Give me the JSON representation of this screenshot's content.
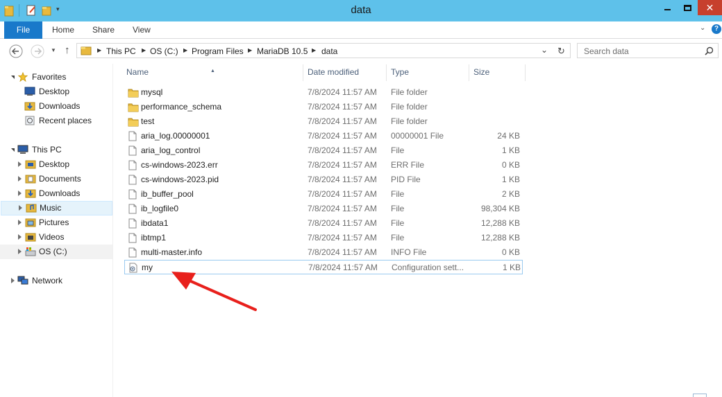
{
  "window": {
    "title": "data"
  },
  "ribbon": {
    "tabs": [
      "File",
      "Home",
      "Share",
      "View"
    ]
  },
  "address": {
    "crumbs": [
      "This PC",
      "OS (C:)",
      "Program Files",
      "MariaDB 10.5",
      "data"
    ]
  },
  "search": {
    "placeholder": "Search data"
  },
  "nav": {
    "favorites": "Favorites",
    "fav_items": [
      "Desktop",
      "Downloads",
      "Recent places"
    ],
    "this_pc": "This PC",
    "pc_items": [
      "Desktop",
      "Documents",
      "Downloads",
      "Music",
      "Pictures",
      "Videos",
      "OS (C:)"
    ],
    "network": "Network"
  },
  "columns": {
    "name": "Name",
    "date": "Date modified",
    "type": "Type",
    "size": "Size"
  },
  "files": [
    {
      "name": "mysql",
      "date": "7/8/2024 11:57 AM",
      "type": "File folder",
      "size": "",
      "icon": "folder-icon"
    },
    {
      "name": "performance_schema",
      "date": "7/8/2024 11:57 AM",
      "type": "File folder",
      "size": "",
      "icon": "folder-icon"
    },
    {
      "name": "test",
      "date": "7/8/2024 11:57 AM",
      "type": "File folder",
      "size": "",
      "icon": "folder-icon"
    },
    {
      "name": "aria_log.00000001",
      "date": "7/8/2024 11:57 AM",
      "type": "00000001 File",
      "size": "24 KB",
      "icon": "file-icon"
    },
    {
      "name": "aria_log_control",
      "date": "7/8/2024 11:57 AM",
      "type": "File",
      "size": "1 KB",
      "icon": "file-icon"
    },
    {
      "name": "cs-windows-2023.err",
      "date": "7/8/2024 11:57 AM",
      "type": "ERR File",
      "size": "0 KB",
      "icon": "file-icon"
    },
    {
      "name": "cs-windows-2023.pid",
      "date": "7/8/2024 11:57 AM",
      "type": "PID File",
      "size": "1 KB",
      "icon": "file-icon"
    },
    {
      "name": "ib_buffer_pool",
      "date": "7/8/2024 11:57 AM",
      "type": "File",
      "size": "2 KB",
      "icon": "file-icon"
    },
    {
      "name": "ib_logfile0",
      "date": "7/8/2024 11:57 AM",
      "type": "File",
      "size": "98,304 KB",
      "icon": "file-icon"
    },
    {
      "name": "ibdata1",
      "date": "7/8/2024 11:57 AM",
      "type": "File",
      "size": "12,288 KB",
      "icon": "file-icon"
    },
    {
      "name": "ibtmp1",
      "date": "7/8/2024 11:57 AM",
      "type": "File",
      "size": "12,288 KB",
      "icon": "file-icon"
    },
    {
      "name": "multi-master.info",
      "date": "7/8/2024 11:57 AM",
      "type": "INFO File",
      "size": "0 KB",
      "icon": "file-icon"
    },
    {
      "name": "my",
      "date": "7/8/2024 11:57 AM",
      "type": "Configuration sett...",
      "size": "1 KB",
      "icon": "config-file-icon"
    }
  ],
  "colors": {
    "titlebar": "#5ec1ea",
    "file_tab": "#1979ca",
    "close": "#c7402d",
    "annotation_arrow": "#e8201c"
  }
}
